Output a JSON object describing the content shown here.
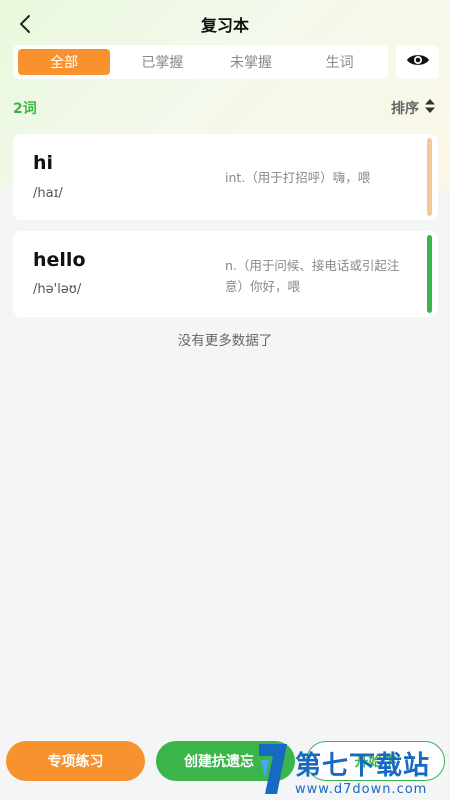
{
  "header": {
    "title": "复习本",
    "back_icon": "chevron-left-icon"
  },
  "tabs": [
    {
      "label": "全部",
      "active": true
    },
    {
      "label": "已掌握",
      "active": false
    },
    {
      "label": "未掌握",
      "active": false
    },
    {
      "label": "生词",
      "active": false
    }
  ],
  "toolbar": {
    "eye_icon": "eye-icon",
    "count": "2词",
    "sort_label": "排序",
    "sort_icon": "sort-icon"
  },
  "words": [
    {
      "word": "hi",
      "phonetic": "/haɪ/",
      "definition": "int.（用于打招呼）嗨，喂",
      "status_color": "#f5c89a"
    },
    {
      "word": "hello",
      "phonetic": "/hə'ləʊ/",
      "definition": "n.（用于问候、接电话或引起注意）你好，喂",
      "status_color": "#3bb54a"
    }
  ],
  "list_footer": "没有更多数据了",
  "bottom": {
    "practice_label": "专项练习",
    "create_label": "创建抗遗忘",
    "third_label": "开始学",
    "colors": {
      "orange": "#f7922e",
      "green": "#3bb54a"
    }
  },
  "watermark": {
    "cn": "第七下载站",
    "url": "www.d7down.com"
  }
}
